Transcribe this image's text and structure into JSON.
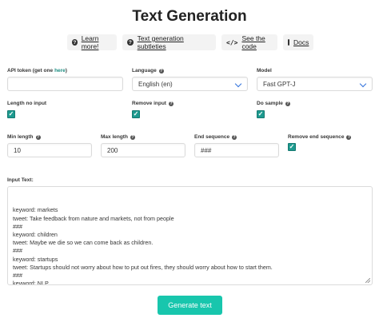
{
  "page_title": "Text Generation",
  "links": {
    "learn_more": "Learn more!",
    "subtleties": "Text generation subtleties",
    "see_code": "See the code",
    "docs": "Docs"
  },
  "fields": {
    "api_token": {
      "label": "API token (get one ",
      "link": "here",
      "label_end": ")",
      "value": ""
    },
    "language": {
      "label": "Language",
      "value": "English (en)"
    },
    "model": {
      "label": "Model",
      "value": "Fast GPT-J"
    },
    "length_no_input": {
      "label": "Length no input",
      "checked": true
    },
    "remove_input": {
      "label": "Remove input",
      "checked": true
    },
    "do_sample": {
      "label": "Do sample",
      "checked": true
    },
    "min_length": {
      "label": "Min length",
      "value": "10"
    },
    "max_length": {
      "label": "Max length",
      "value": "200"
    },
    "end_sequence": {
      "label": "End sequence",
      "value": "###"
    },
    "remove_end_sequence": {
      "label": "Remove end sequence",
      "checked": true
    },
    "input_text": {
      "label": "Input Text:",
      "value": "keyword: markets\ntweet: Take feedback from nature and markets, not from people\n###\nkeyword: children\ntweet: Maybe we die so we can come back as children.\n###\nkeyword: startups\ntweet: Startups should not worry about how to put out fires, they should worry about how to start them.\n###\nkeyword: NLP\ntweet:"
    }
  },
  "generate_button": "Generate text",
  "colors": {
    "accent": "#18c6ad",
    "checkbox": "#1d9a8f",
    "link": "#1f8e83",
    "select_arrow": "#3273dc"
  }
}
